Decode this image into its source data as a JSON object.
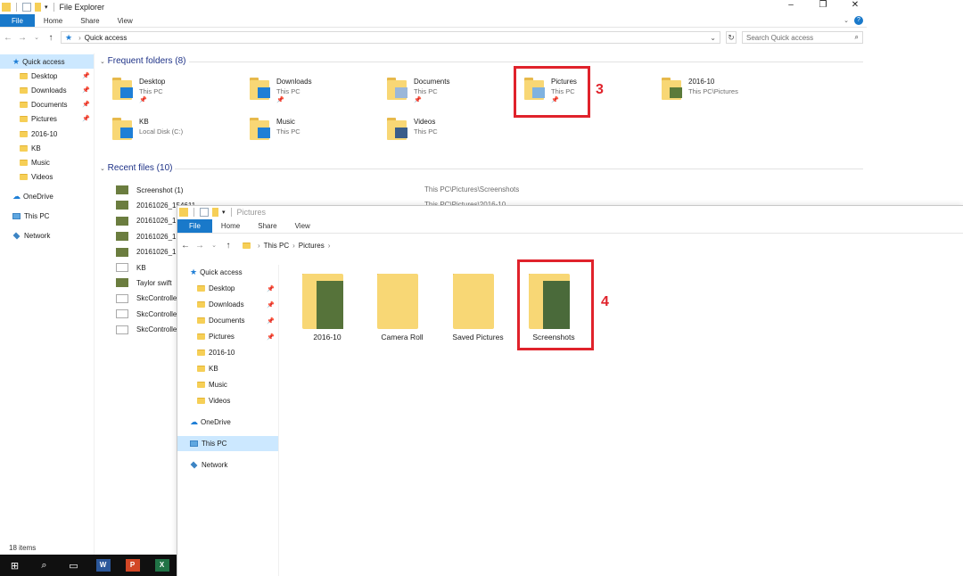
{
  "win1": {
    "title": "File Explorer",
    "tabs": [
      "File",
      "Home",
      "Share",
      "View"
    ],
    "address": "Quick access",
    "search_placeholder": "Search Quick access",
    "sidebar": [
      {
        "label": "Quick access",
        "icon": "star-icon",
        "selected": true
      },
      {
        "label": "Desktop",
        "icon": "folder-icon",
        "pinned": true
      },
      {
        "label": "Downloads",
        "icon": "folder-icon",
        "pinned": true
      },
      {
        "label": "Documents",
        "icon": "folder-icon",
        "pinned": true
      },
      {
        "label": "Pictures",
        "icon": "folder-icon",
        "pinned": true
      },
      {
        "label": "2016-10",
        "icon": "folder-icon"
      },
      {
        "label": "KB",
        "icon": "folder-icon"
      },
      {
        "label": "Music",
        "icon": "folder-icon"
      },
      {
        "label": "Videos",
        "icon": "folder-icon"
      },
      {
        "label": "OneDrive",
        "icon": "cloud-icon"
      },
      {
        "label": "This PC",
        "icon": "pc-icon"
      },
      {
        "label": "Network",
        "icon": "network-icon"
      }
    ],
    "frequent_header": "Frequent folders (8)",
    "frequent": [
      {
        "name": "Desktop",
        "sub": "This PC",
        "pinned": true,
        "badge": "#1f7fd6"
      },
      {
        "name": "Downloads",
        "sub": "This PC",
        "pinned": true,
        "badge": "#1f7fd6"
      },
      {
        "name": "Documents",
        "sub": "This PC",
        "pinned": true,
        "badge": "#9ab7d9"
      },
      {
        "name": "Pictures",
        "sub": "This PC",
        "pinned": true,
        "badge": "#7fb2e0"
      },
      {
        "name": "2016-10",
        "sub": "This PC\\Pictures",
        "pinned": false,
        "badge": "#5b7a3a"
      },
      {
        "name": "KB",
        "sub": "Local Disk (C:)",
        "pinned": false,
        "badge": "#1f7fd6"
      },
      {
        "name": "Music",
        "sub": "This PC",
        "pinned": false,
        "badge": "#1f7fd6"
      },
      {
        "name": "Videos",
        "sub": "This PC",
        "pinned": false,
        "badge": "#3a5d8a"
      }
    ],
    "recent_header": "Recent files (10)",
    "recent": [
      {
        "name": "Screenshot (1)",
        "path": "This PC\\Pictures\\Screenshots",
        "thumb": "image"
      },
      {
        "name": "20161026_154611",
        "path": "This PC\\Pictures\\2016-10",
        "thumb": "image"
      },
      {
        "name": "20161026_1",
        "path": "",
        "thumb": "image"
      },
      {
        "name": "20161026_1",
        "path": "",
        "thumb": "image"
      },
      {
        "name": "20161026_1",
        "path": "",
        "thumb": "image"
      },
      {
        "name": "KB",
        "path": "",
        "thumb": "doc"
      },
      {
        "name": "Taylor swift",
        "path": "",
        "thumb": "image"
      },
      {
        "name": "SkcControlle",
        "path": "",
        "thumb": "doc"
      },
      {
        "name": "SkcControlle",
        "path": "",
        "thumb": "doc"
      },
      {
        "name": "SkcControlle",
        "path": "",
        "thumb": "doc"
      }
    ],
    "status": "18 items",
    "step_label": "3"
  },
  "win2": {
    "title": "Pictures",
    "tabs": [
      "File",
      "Home",
      "Share",
      "View"
    ],
    "breadcrumb": [
      "This PC",
      "Pictures"
    ],
    "sidebar": [
      {
        "label": "Quick access",
        "icon": "star-icon"
      },
      {
        "label": "Desktop",
        "icon": "folder-icon",
        "pinned": true
      },
      {
        "label": "Downloads",
        "icon": "folder-icon",
        "pinned": true
      },
      {
        "label": "Documents",
        "icon": "folder-icon",
        "pinned": true
      },
      {
        "label": "Pictures",
        "icon": "folder-icon",
        "pinned": true
      },
      {
        "label": "2016-10",
        "icon": "folder-icon"
      },
      {
        "label": "KB",
        "icon": "folder-icon"
      },
      {
        "label": "Music",
        "icon": "folder-icon"
      },
      {
        "label": "Videos",
        "icon": "folder-icon"
      },
      {
        "label": "OneDrive",
        "icon": "cloud-icon"
      },
      {
        "label": "This PC",
        "icon": "pc-icon",
        "selected": true
      },
      {
        "label": "Network",
        "icon": "network-icon"
      }
    ],
    "folders": [
      {
        "name": "2016-10",
        "preview": "#56733a"
      },
      {
        "name": "Camera Roll",
        "preview": ""
      },
      {
        "name": "Saved Pictures",
        "preview": ""
      },
      {
        "name": "Screenshots",
        "preview": "#4a6a3a"
      }
    ],
    "step_label": "4"
  },
  "taskbar": {
    "apps": [
      {
        "name": "start",
        "label": "⊞"
      },
      {
        "name": "search",
        "label": "⌕"
      },
      {
        "name": "task-view",
        "label": "▭"
      },
      {
        "name": "word",
        "label": "W",
        "color": "#2b579a"
      },
      {
        "name": "powerpoint",
        "label": "P",
        "color": "#d24726"
      },
      {
        "name": "excel",
        "label": "X",
        "color": "#217346"
      }
    ]
  },
  "colors": {
    "accent": "#1979ca",
    "highlight": "#e0222b",
    "folder": "#f8d775"
  }
}
